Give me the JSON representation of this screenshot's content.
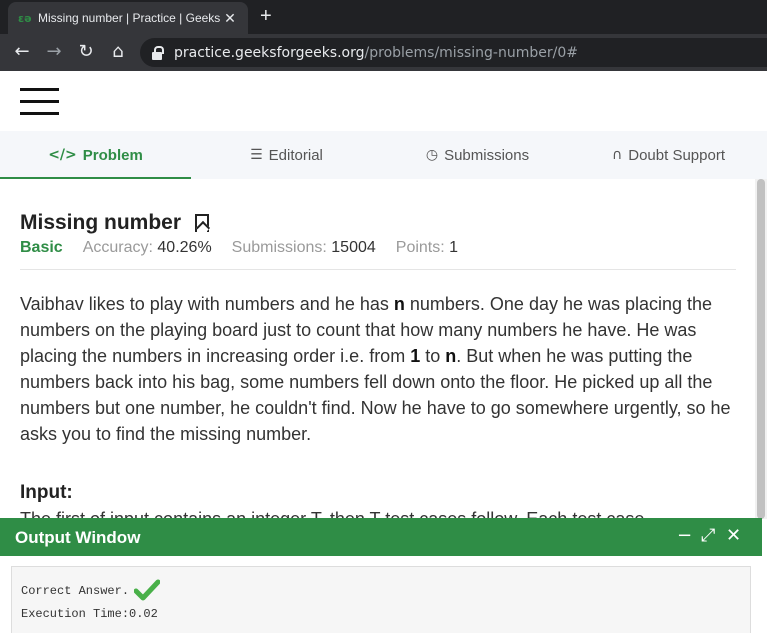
{
  "browser": {
    "tab_favicon": "εə",
    "tab_title": "Missing number | Practice | Geeks",
    "tab_close": "✕",
    "new_tab": "+",
    "url_host": "practice.geeksforgeeks.org",
    "url_path": "/problems/missing-number/0#",
    "back_icon": "←",
    "forward_icon": "→",
    "reload_icon": "↻",
    "home_icon": "⌂"
  },
  "tabs": [
    {
      "label": "Problem",
      "icon": "</>"
    },
    {
      "label": "Editorial",
      "icon": "☰"
    },
    {
      "label": "Submissions",
      "icon": "◷"
    },
    {
      "label": "Doubt Support",
      "icon": "∩"
    }
  ],
  "problem": {
    "title": "Missing number",
    "difficulty": "Basic",
    "accuracy_label": "Accuracy:",
    "accuracy_value": "40.26%",
    "submissions_label": "Submissions:",
    "submissions_value": "15004",
    "points_label": "Points:",
    "points_value": "1",
    "desc_1": "Vaibhav likes to play with numbers and he has ",
    "desc_n1": "n",
    "desc_2": " numbers. One day he was placing the numbers on the playing board just to count that how many numbers he have. He was placing the numbers in increasing order i.e. from ",
    "desc_one": "1",
    "desc_3": " to ",
    "desc_n2": "n",
    "desc_4": ". But when he was putting the numbers back into his bag, some numbers fell down onto the floor. He picked up all the numbers but one number, he couldn't find. Now he have to go somewhere urgently, so he asks you to find the missing number.",
    "input_heading": "Input:",
    "input_cut": "The first of input contains an integer T, then T test cases follow. Each test case"
  },
  "output_window": {
    "title": "Output Window",
    "minimize": "−",
    "expand": "⤢",
    "close": "✕",
    "line1": "Correct Answer.",
    "line2": "Execution Time:0.02"
  },
  "colors": {
    "brand_green": "#2f8d46"
  }
}
